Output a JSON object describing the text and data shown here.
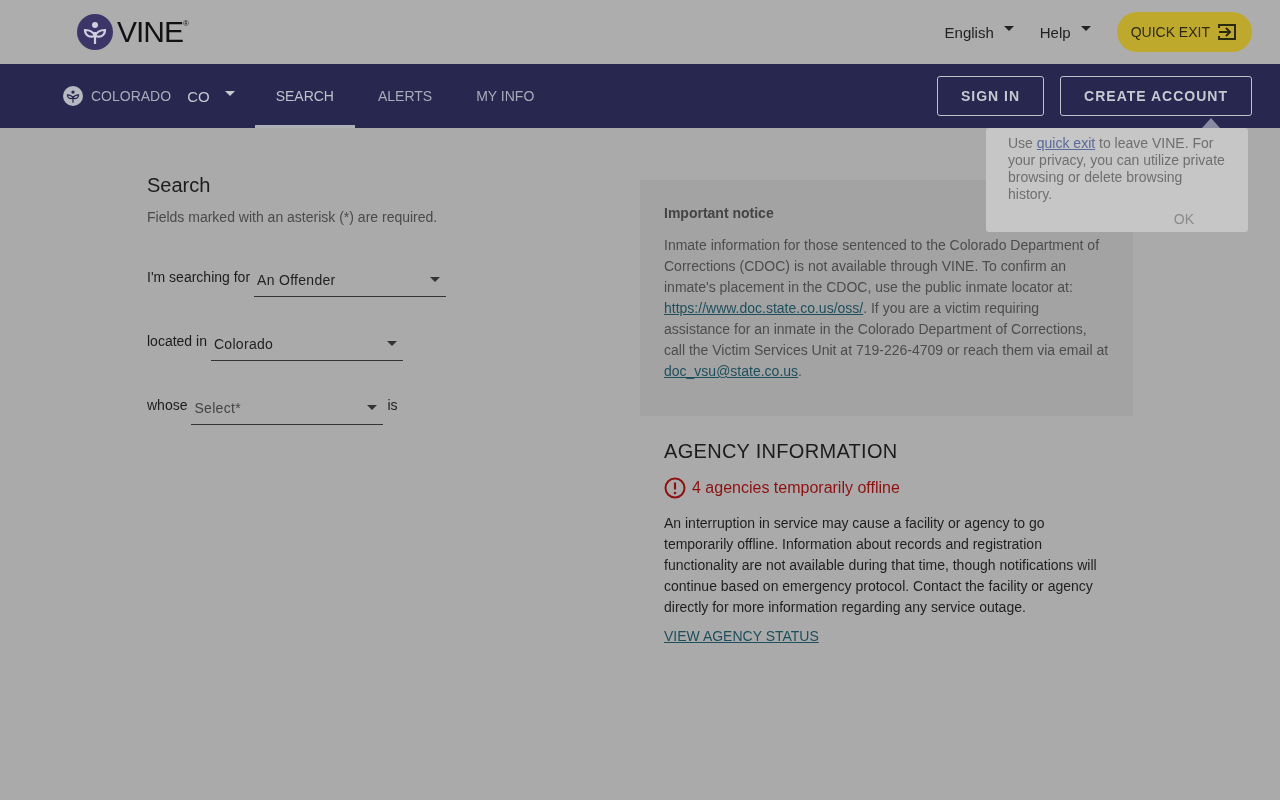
{
  "header": {
    "logo_text": "VINE",
    "logo_mark": "®",
    "language": "English",
    "help": "Help",
    "quick_exit": "QUICK EXIT"
  },
  "nav": {
    "state_name": "COLORADO",
    "state_code": "CO",
    "tabs": [
      {
        "label": "SEARCH",
        "selected": true
      },
      {
        "label": "ALERTS",
        "selected": false
      },
      {
        "label": "MY INFO",
        "selected": false
      }
    ],
    "buttons": [
      "SIGN IN",
      "CREATE ACCOUNT"
    ]
  },
  "popup": {
    "parts": [
      {
        "kind": "text",
        "text": "Use "
      },
      {
        "kind": "link",
        "text": "quick exit"
      },
      {
        "kind": "text",
        "text": " to leave VINE. For your privacy, you can utilize private browsing or delete browsing history."
      }
    ],
    "button": "OK"
  },
  "search": {
    "title": "Search",
    "hint": "Fields marked with an asterisk (*) are required.",
    "rows": [
      {
        "label": "I'm searching for",
        "value": "An Offender"
      },
      {
        "label": "located in",
        "value": "Colorado"
      },
      {
        "label": "whose",
        "placeholder": "Select*",
        "suffix": "is"
      }
    ]
  },
  "notice": {
    "title": "Important notice",
    "parts": [
      {
        "kind": "text",
        "text": "Inmate information for those sentenced to the Colorado Department of Corrections (CDOC) is not available through VINE. To confirm an inmate's placement in the CDOC, use the public inmate locator at: "
      },
      {
        "kind": "link",
        "text": "https://www.doc.state.co.us/oss/"
      },
      {
        "kind": "text",
        "text": ". If you are a victim requiring assistance for an inmate in the Colorado Department of Corrections, call the Victim Services Unit at 719-226-4709 or reach them via email at "
      },
      {
        "kind": "link",
        "text": "doc_vsu@state.co.us"
      },
      {
        "kind": "text",
        "text": "."
      }
    ]
  },
  "agency": {
    "title": "AGENCY INFORMATION",
    "alert": "4 agencies temporarily offline",
    "body": "An interruption in service may cause a facility or agency to go temporarily offline. Information about records and registration functionality are not available during that time, though notifications will continue based on emergency protocol. Contact the facility or agency directly for more information regarding any service outage.",
    "link": "VIEW AGENCY STATUS"
  }
}
